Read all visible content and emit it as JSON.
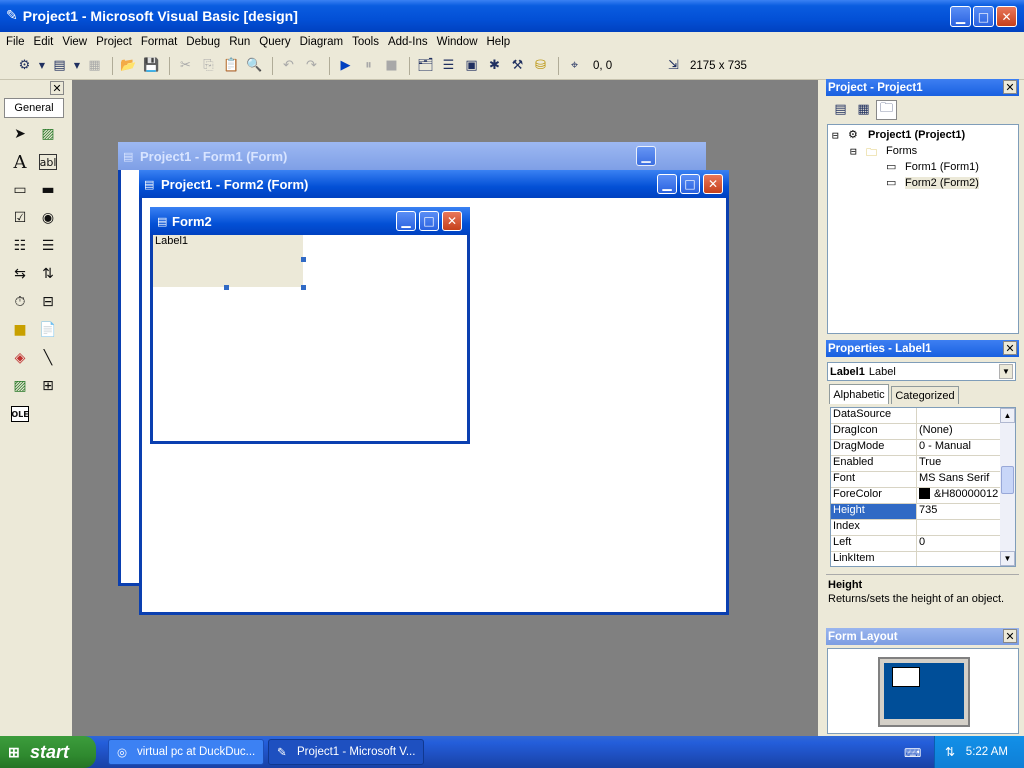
{
  "app": {
    "title": "Project1 - Microsoft Visual Basic [design]"
  },
  "menu": [
    "File",
    "Edit",
    "View",
    "Project",
    "Format",
    "Debug",
    "Run",
    "Query",
    "Diagram",
    "Tools",
    "Add-Ins",
    "Window",
    "Help"
  ],
  "toolbar": {
    "position": "0, 0",
    "size": "2175 x 735"
  },
  "toolbox": {
    "tab": "General",
    "tool_abl": "abl",
    "tool_ole": "OLE"
  },
  "windows": {
    "form1_caption": "Project1 - Form1 (Form)",
    "form2_caption": "Project1 - Form2 (Form)",
    "form2_inner_caption": "Form2",
    "label_text": "Label1"
  },
  "project_explorer": {
    "title": "Project - Project1",
    "root": "Project1 (Project1)",
    "folder": "Forms",
    "items": [
      "Form1 (Form1)",
      "Form2 (Form2)"
    ]
  },
  "properties": {
    "title": "Properties - Label1",
    "object": "Label1",
    "object_type": "Label",
    "tabs": [
      "Alphabetic",
      "Categorized"
    ],
    "rows": [
      {
        "name": "DataSource",
        "value": ""
      },
      {
        "name": "DragIcon",
        "value": "(None)"
      },
      {
        "name": "DragMode",
        "value": "0 - Manual"
      },
      {
        "name": "Enabled",
        "value": "True"
      },
      {
        "name": "Font",
        "value": "MS Sans Serif"
      },
      {
        "name": "ForeColor",
        "value": "&H80000012"
      },
      {
        "name": "Height",
        "value": "735"
      },
      {
        "name": "Index",
        "value": ""
      },
      {
        "name": "Left",
        "value": "0"
      },
      {
        "name": "LinkItem",
        "value": ""
      }
    ],
    "desc_title": "Height",
    "desc_text": "Returns/sets the height of an object."
  },
  "form_layout": {
    "title": "Form Layout"
  },
  "taskbar": {
    "start": "start",
    "tasks": [
      "virtual pc at DuckDuc...",
      "Project1 - Microsoft V..."
    ],
    "clock": "5:22 AM"
  },
  "colors": {
    "accent": "#0350d6",
    "selection": "#316ac5",
    "mdi_bg": "#808080"
  }
}
